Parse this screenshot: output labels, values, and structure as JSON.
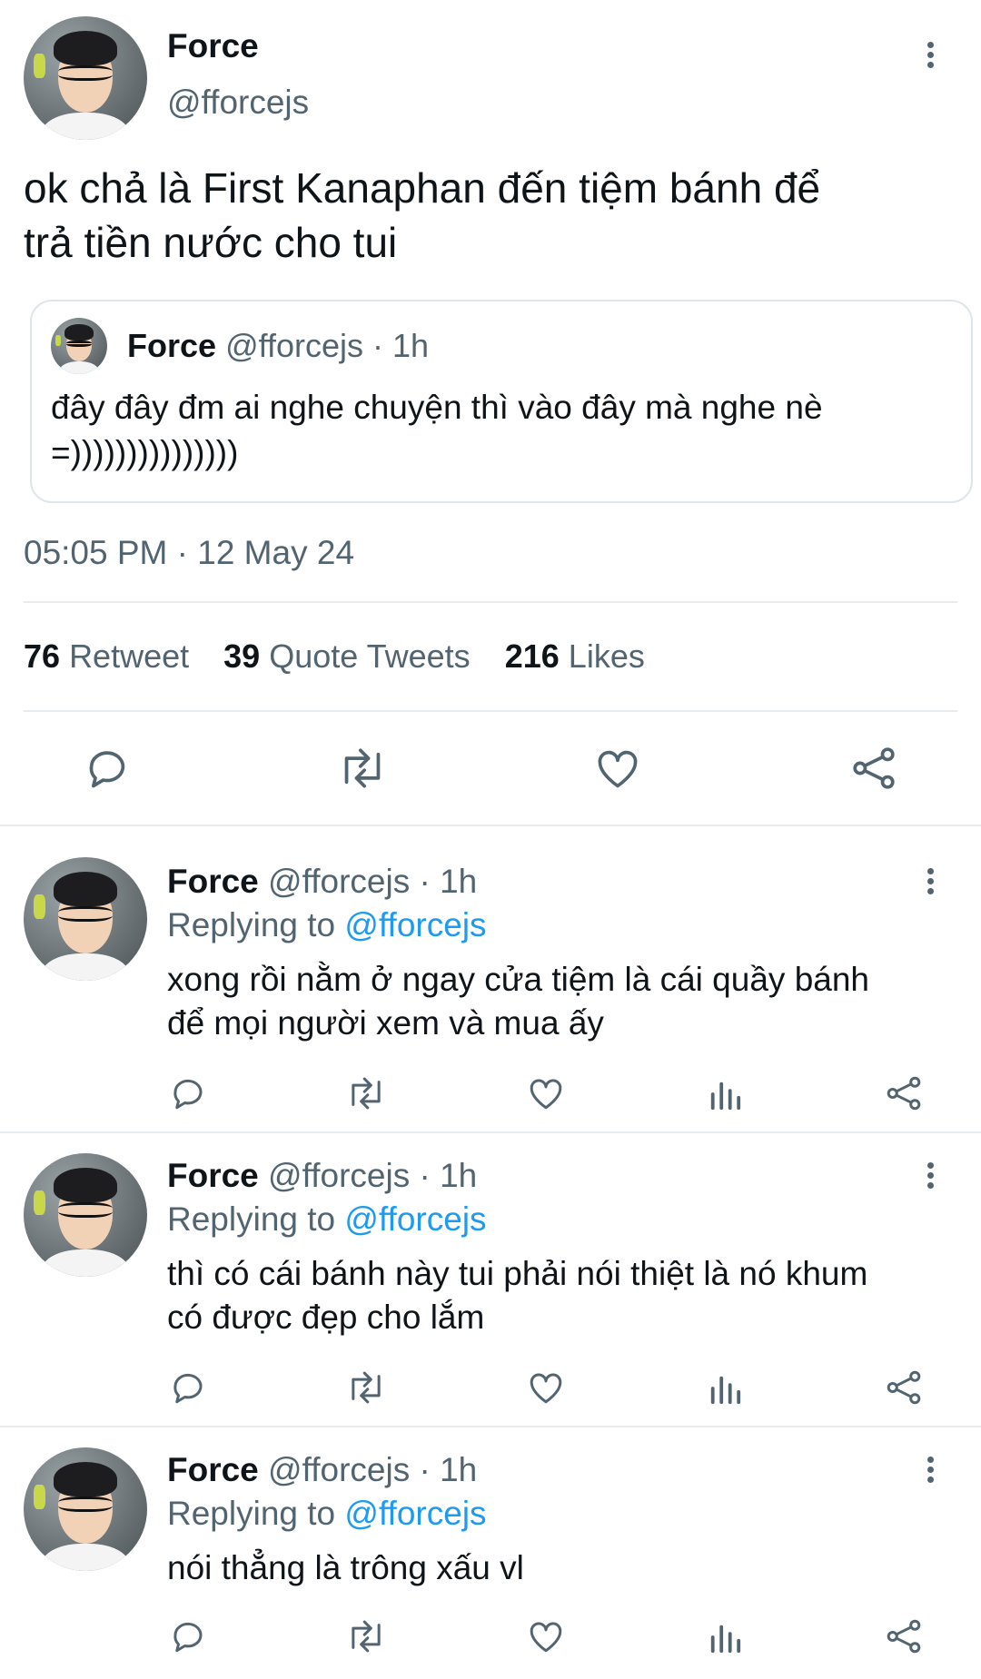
{
  "main_tweet": {
    "author_name": "Force",
    "author_handle": "@fforcejs",
    "text_line1": "ok chả là First Kanaphan đến tiệm bánh để",
    "text_line2": "trả tiền nước cho tui",
    "quote": {
      "author_name": "Force",
      "author_handle": "@fforcejs",
      "time": "· 1h",
      "text_line1": "đây đây đm ai nghe chuyện thì vào đây mà nghe nè",
      "text_line2": "=)))))))))))))))"
    },
    "timestamp": "05:05 PM · 12 May 24",
    "stats": {
      "retweets_count": "76",
      "retweets_label": "Retweet",
      "quotes_count": "39",
      "quotes_label": "Quote Tweets",
      "likes_count": "216",
      "likes_label": "Likes"
    },
    "actions": [
      "reply-icon",
      "retweet-icon",
      "like-icon",
      "share-icon"
    ]
  },
  "replies": [
    {
      "author_name": "Force",
      "author_handle": "@fforcejs",
      "time": "· 1h",
      "replying_prefix": "Replying to",
      "replying_handle": "@fforcejs",
      "text_line1": "xong rồi nằm ở ngay cửa tiệm là cái quầy bánh",
      "text_line2": "để mọi người xem và mua ấy"
    },
    {
      "author_name": "Force",
      "author_handle": "@fforcejs",
      "time": "· 1h",
      "replying_prefix": "Replying to",
      "replying_handle": "@fforcejs",
      "text_line1": "thì có cái bánh này tui phải nói thiệt là nó khum",
      "text_line2": "có được đẹp cho lắm"
    },
    {
      "author_name": "Force",
      "author_handle": "@fforcejs",
      "time": "· 1h",
      "replying_prefix": "Replying to",
      "replying_handle": "@fforcejs",
      "text_line1": "nói thẳng là trông xấu vl",
      "text_line2": ""
    }
  ],
  "colors": {
    "text": "#0f1419",
    "secondary": "#536471",
    "link": "#1d9bf0",
    "divider": "#e8ecee"
  }
}
